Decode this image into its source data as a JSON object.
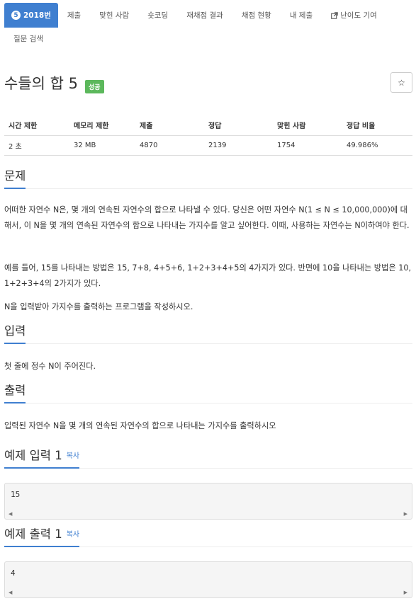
{
  "nav": {
    "tabs": [
      {
        "label": "2018번",
        "badge": "5"
      },
      {
        "label": "제출"
      },
      {
        "label": "맞힌 사람"
      },
      {
        "label": "숏코딩"
      },
      {
        "label": "재채점 결과"
      },
      {
        "label": "채점 현황"
      },
      {
        "label": "내 제출"
      },
      {
        "label": "난이도 기여",
        "icon": "external-link-icon"
      }
    ],
    "search": "질문 검색"
  },
  "problem": {
    "title": "수들의 합 5",
    "status": "성공",
    "star": "☆"
  },
  "info_table": {
    "headers": [
      "시간 제한",
      "메모리 제한",
      "제출",
      "정답",
      "맞힌 사람",
      "정답 비율"
    ],
    "values": [
      "2 초",
      "32 MB",
      "4870",
      "2139",
      "1754",
      "49.986%"
    ]
  },
  "sections": {
    "description": {
      "heading": "문제",
      "paragraphs": [
        "어떠한 자연수 N은, 몇 개의 연속된 자연수의 합으로 나타낼 수 있다. 당신은 어떤 자연수 N(1 ≤ N ≤ 10,000,000)에 대해서, 이 N을 몇 개의 연속된 자연수의 합으로 나타내는 가지수를 알고 싶어한다. 이때, 사용하는 자연수는 N이하여야 한다.",
        "예를 들어, 15를 나타내는 방법은 15, 7+8, 4+5+6, 1+2+3+4+5의 4가지가 있다. 반면에 10을 나타내는 방법은 10, 1+2+3+4의 2가지가 있다.",
        "N을 입력받아 가지수를 출력하는 프로그램을 작성하시오."
      ]
    },
    "input": {
      "heading": "입력",
      "text": "첫 줄에 정수 N이 주어진다."
    },
    "output": {
      "heading": "출력",
      "text": "입력된 자연수 N을 몇 개의 연속된 자연수의 합으로 나타내는 가지수를 출력하시오"
    },
    "sample_input": {
      "heading": "예제 입력 1",
      "copy": "복사",
      "code": "15"
    },
    "sample_output": {
      "heading": "예제 출력 1",
      "copy": "복사",
      "code": "4"
    }
  },
  "colors": {
    "accent": "#3f7fd0",
    "success": "#5cb85c"
  }
}
